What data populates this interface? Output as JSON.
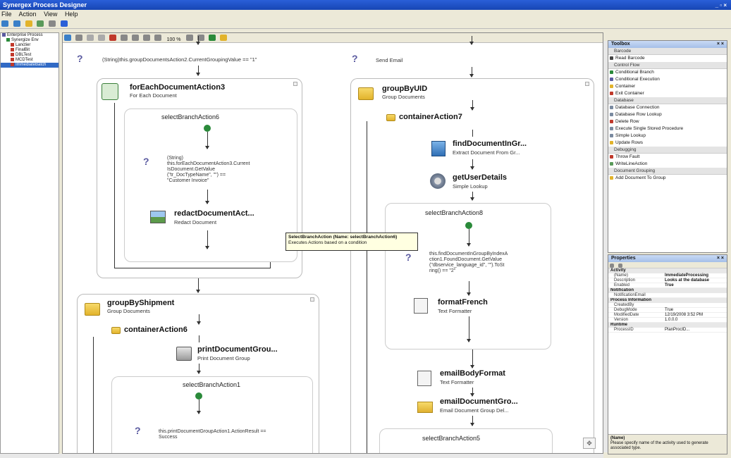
{
  "window": {
    "title": "Synergex Process Designer",
    "controls": "_ ▫ ×"
  },
  "menu": [
    "File",
    "Action",
    "View",
    "Help"
  ],
  "tree": {
    "items": [
      "Enterprise Process",
      "Synergize Env",
      "Lanctier",
      "FinalBit",
      "DBLTest",
      "MCDTest",
      "ImmediateBatch"
    ]
  },
  "designer": {
    "toolbar": {
      "zoom": "100 %"
    },
    "left_column": {
      "top_condition": "(String)this.groupDocumentsAction2.CurrentGroupingValue == \"1\"",
      "foreach": {
        "title": "forEachDocumentAction3",
        "subtitle": "For Each Document"
      },
      "branch": {
        "label": "selectBranchAction6"
      },
      "branch_condition": "(String)\nthis.forEachDocumentAction3.Current\nIsDocument.GetValue\n(\"tr_DocTypeName\", \"\") ==\n\"Customer Invoice\"",
      "redact": {
        "title": "redactDocumentAct...",
        "subtitle": "Redact Document"
      },
      "group_shipment": {
        "title": "groupByShipment",
        "subtitle": "Group Documents"
      },
      "container6": {
        "title": "containerAction6"
      },
      "print": {
        "title": "printDocumentGrou...",
        "subtitle": "Print Document Group"
      },
      "branch1": {
        "label": "selectBranchAction1"
      },
      "branch1_condition": "this.printDocumentGroupAction1.ActionResult == Success"
    },
    "right_column": {
      "send_email": "Send Email",
      "group_uid": {
        "title": "groupByUID",
        "subtitle": "Group Documents"
      },
      "container7": {
        "title": "containerAction7"
      },
      "find": {
        "title": "findDocumentInGr...",
        "subtitle": "Extract Document From Gr..."
      },
      "user_details": {
        "title": "getUserDetails",
        "subtitle": "Simple Lookup"
      },
      "branch8": {
        "label": "selectBranchAction8"
      },
      "branch8_condition": "this.findDocumentInGroupByIndexA\nction1.FoundDocument.GetValue\n(\"dbservice_language_id\", \"\").ToSt\nring() == \"2\"",
      "format_french": {
        "title": "formatFrench",
        "subtitle": "Text Formatter"
      },
      "email_body": {
        "title": "emailBodyFormat",
        "subtitle": "Text Formatter"
      },
      "email_doc": {
        "title": "emailDocumentGro...",
        "subtitle": "Email Document Group Del..."
      },
      "branch5": {
        "label": "selectBranchAction5"
      }
    },
    "tooltip": {
      "title": "SelectBranchAction (Name: selectBranchAction6)",
      "body": "Executes Actions based on a condition"
    }
  },
  "toolbox": {
    "title": "Toolbox",
    "sections": [
      {
        "type": "group",
        "label": "Barcode"
      },
      {
        "type": "item",
        "label": "Read Barcode",
        "color": "#444"
      },
      {
        "type": "group",
        "label": "Control Flow"
      },
      {
        "type": "item",
        "label": "Conditional Branch",
        "color": "#2a8a3a"
      },
      {
        "type": "item",
        "label": "Conditional Execution",
        "color": "#5a5aa0"
      },
      {
        "type": "item",
        "label": "Container",
        "color": "#e2b32b"
      },
      {
        "type": "item",
        "label": "Exit Container",
        "color": "#c0392b"
      },
      {
        "type": "group",
        "label": "Database"
      },
      {
        "type": "item",
        "label": "Database Connection",
        "color": "#7a8aa0"
      },
      {
        "type": "item",
        "label": "Database Row Lookup",
        "color": "#7a8aa0"
      },
      {
        "type": "item",
        "label": "Delete Row",
        "color": "#c0392b"
      },
      {
        "type": "item",
        "label": "Execute Single Stored Procedure",
        "color": "#7a8aa0"
      },
      {
        "type": "item",
        "label": "Simple Lookup",
        "color": "#7a8aa0"
      },
      {
        "type": "item",
        "label": "Update Rows",
        "color": "#e2b32b"
      },
      {
        "type": "group",
        "label": "Debugging"
      },
      {
        "type": "item",
        "label": "Throw Fault",
        "color": "#c0392b"
      },
      {
        "type": "item",
        "label": "WriteLineAction",
        "color": "#5a9a5a"
      },
      {
        "type": "group",
        "label": "Document Grouping"
      },
      {
        "type": "item",
        "label": "Add Document To Group",
        "color": "#e2b32b"
      }
    ]
  },
  "properties": {
    "title": "Properties",
    "categories": [
      {
        "name": "Activity",
        "rows": [
          {
            "k": "(Name)",
            "v": "ImmediateProcessing"
          },
          {
            "k": "Description",
            "v": "Looks at the database"
          },
          {
            "k": "Enabled",
            "v": "True"
          }
        ]
      },
      {
        "name": "Notification",
        "rows": [
          {
            "k": "NotificationEmail",
            "v": ""
          }
        ]
      },
      {
        "name": "Process Information",
        "rows": [
          {
            "k": "CreatedBy",
            "v": ""
          },
          {
            "k": "DebugMode",
            "v": "True"
          },
          {
            "k": "ModifiedDate",
            "v": "12/19/2008 3:52 PM"
          },
          {
            "k": "Version",
            "v": "1.0.0.0"
          }
        ]
      },
      {
        "name": "Runtime",
        "rows": [
          {
            "k": "ProcessID",
            "v": "PlanProcID..."
          }
        ]
      }
    ],
    "desc_title": "(Name)",
    "desc_text": "Please specify name of the activity used to generate associated type."
  }
}
